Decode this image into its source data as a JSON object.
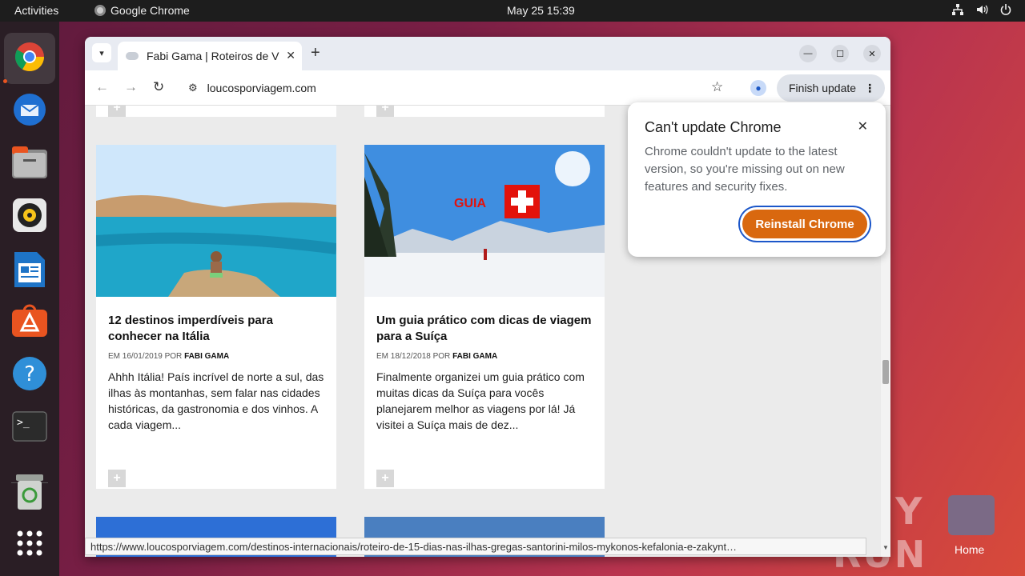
{
  "topbar": {
    "activities": "Activities",
    "app_name": "Google Chrome",
    "clock": "May 25  15:39",
    "tray_icons": [
      "network-icon",
      "volume-icon",
      "power-icon"
    ]
  },
  "dock": {
    "items": [
      {
        "name": "chrome",
        "icon": "chrome-icon",
        "active": true
      },
      {
        "name": "thunderbird",
        "icon": "thunderbird-icon"
      },
      {
        "name": "files",
        "icon": "files-icon"
      },
      {
        "name": "rhythmbox",
        "icon": "rhythmbox-icon"
      },
      {
        "name": "writer",
        "icon": "libreoffice-writer-icon"
      },
      {
        "name": "software",
        "icon": "app-center-icon"
      },
      {
        "name": "help",
        "icon": "help-icon"
      },
      {
        "name": "terminal",
        "icon": "terminal-icon"
      },
      {
        "name": "trash",
        "icon": "trash-icon"
      },
      {
        "name": "apps",
        "icon": "show-apps-icon"
      }
    ]
  },
  "desktop": {
    "home_label": "Home",
    "watermark": "ANY RUN"
  },
  "browser": {
    "tab_title": "Fabi Gama | Roteiros de V",
    "address": "loucosporviagem.com",
    "finish_update_label": "Finish update",
    "status_url": "https://www.loucosporviagem.com/destinos-internacionais/roteiro-de-15-dias-nas-ilhas-gregas-santorini-milos-mykonos-kefalonia-e-zakynt…"
  },
  "page": {
    "cards": [
      {
        "title": "12 destinos imperdíveis para conhecer na Itália",
        "meta_prefix": "EM 16/01/2019 POR",
        "author": "FABI GAMA",
        "excerpt": "Ahhh Itália! País incrível de norte a sul, das ilhas às montanhas, sem falar nas cidades históricas, da gastronomia e dos vinhos. A cada viagem..."
      },
      {
        "title": "Um guia prático com dicas de viagem para a Suíça",
        "meta_prefix": "EM 18/12/2018 POR",
        "author": "FABI GAMA",
        "excerpt": "Finalmente organizei um guia prático com muitas dicas da Suíça para vocês planejarem melhor as viagens por lá! Já visitei a Suíça mais de dez...",
        "image_label": "GUIA"
      }
    ]
  },
  "popup": {
    "title": "Can't update Chrome",
    "body": "Chrome couldn't update to the latest version, so you're missing out on new features and security fixes.",
    "button": "Reinstall Chrome"
  },
  "colors": {
    "accent_orange": "#d9680f",
    "focus_ring": "#1c57c9",
    "dock_bg": "#2a1e25"
  }
}
